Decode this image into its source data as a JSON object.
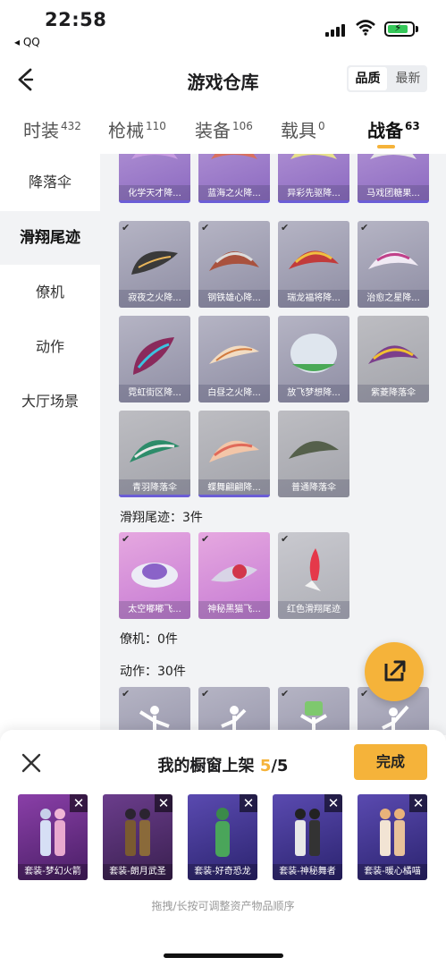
{
  "status_bar": {
    "time": "22:58",
    "back_app": "◂ QQ"
  },
  "nav": {
    "title": "游戏仓库",
    "sort_options": [
      "品质",
      "最新"
    ],
    "sort_selected": "品质"
  },
  "tabs": [
    {
      "label": "时装",
      "count": "432"
    },
    {
      "label": "枪械",
      "count": "110"
    },
    {
      "label": "装备",
      "count": "106"
    },
    {
      "label": "载具",
      "count": "0"
    },
    {
      "label": "战备",
      "count": "63"
    }
  ],
  "sidebar": [
    "降落伞",
    "滑翔尾迹",
    "僚机",
    "动作",
    "大厅场景"
  ],
  "parachutes": [
    "化学天才降...",
    "蓝海之火降...",
    "异彩先驱降...",
    "马戏团糖果...",
    "寂夜之火降...",
    "钢铁雄心降...",
    "瑞龙福将降...",
    "治愈之星降...",
    "霓虹街区降...",
    "白昼之火降...",
    "放飞梦想降...",
    "紫菱降落伞",
    "青羽降落伞",
    "蝶舞翩翩降...",
    "普通降落伞"
  ],
  "sections": {
    "glide_trail": "滑翔尾迹：3件",
    "wingman": "僚机：0件",
    "emote": "动作：30件"
  },
  "glide_trails": [
    "太空嘟嘟飞...",
    "神秘黑猫飞...",
    "红色滑翔尾迹"
  ],
  "sheet": {
    "title_prefix": "我的橱窗上架",
    "count": "5",
    "total": "/5",
    "done_label": "完成",
    "hint": "拖拽/长按可调整资产物品顺序",
    "items": [
      "套装-梦幻火箭",
      "套装-朗月武圣",
      "套装-好奇恐龙",
      "套装-神秘舞者",
      "套装-暖心橘喵"
    ]
  },
  "colors": {
    "accent": "#f5b33a",
    "card_purple": "#8b69c0",
    "card_gray": "#a2a3aa"
  }
}
